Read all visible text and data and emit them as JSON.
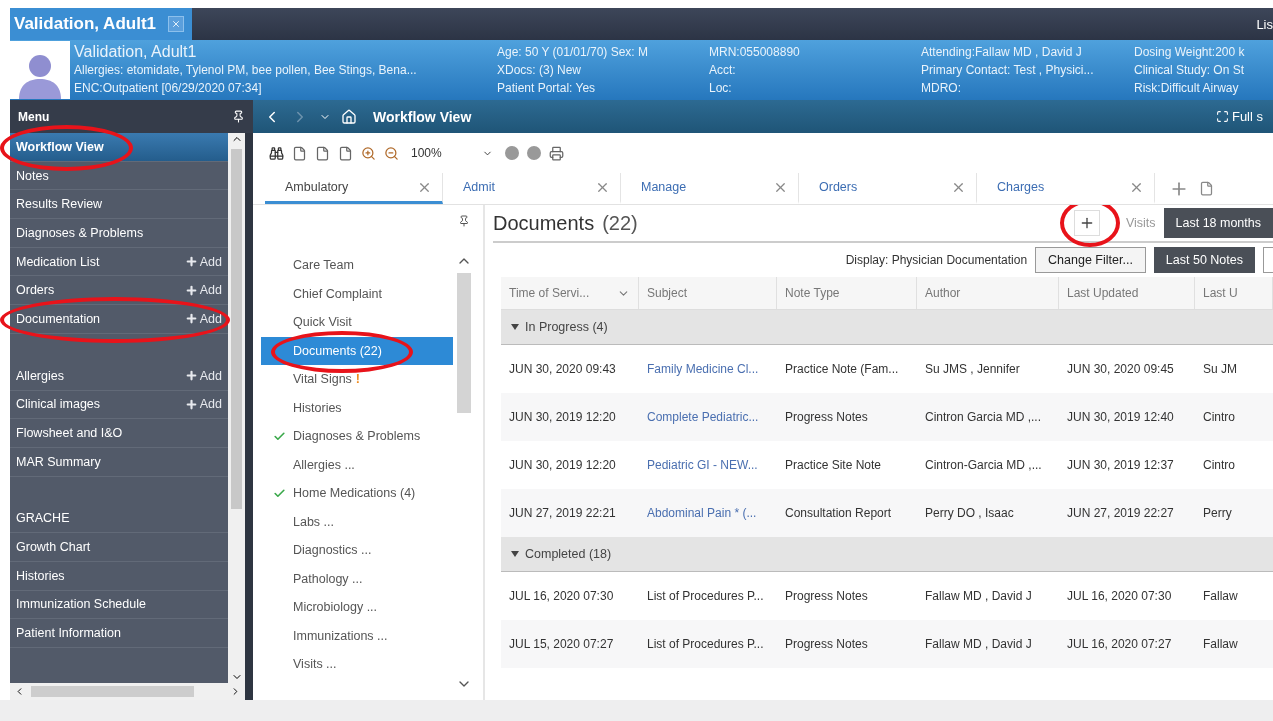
{
  "patient_tab": {
    "label": "Validation, Adult1"
  },
  "title_bar_right": "Lis",
  "banner": {
    "columns": [
      [
        "Validation, Adult1",
        "Allergies: etomidate, Tylenol PM, bee pollen, Bee Stings, Bena...",
        "ENC:Outpatient [06/29/2020 07:34]"
      ],
      [
        "Age: 50 Y (01/01/70) Sex: M",
        "XDocs: (3) New",
        "Patient Portal: Yes"
      ],
      [
        "MRN:055008890",
        "Acct:",
        "Loc:"
      ],
      [
        "Attending:Fallaw MD , David J",
        "Primary Contact: Test , Physici...",
        "MDRO:"
      ],
      [
        "Dosing Weight:200 k",
        "Clinical Study: On St",
        "Risk:Difficult Airway"
      ]
    ]
  },
  "menu": {
    "title": "Menu",
    "groups": [
      {
        "items": [
          {
            "label": "Workflow View",
            "selected": true,
            "circled": true
          },
          {
            "label": "Notes",
            "selected": false,
            "circled": false
          },
          {
            "label": "Results Review",
            "selected": false,
            "circled": false
          },
          {
            "label": "Diagnoses & Problems",
            "selected": false,
            "circled": false
          },
          {
            "label": "Medication List",
            "add": "Add",
            "selected": false,
            "circled": false
          },
          {
            "label": "Orders",
            "add": "Add",
            "selected": false,
            "circled": false
          },
          {
            "label": "Documentation",
            "add": "Add",
            "selected": false,
            "circled": true
          }
        ]
      },
      {
        "items": [
          {
            "label": "Allergies",
            "add": "Add",
            "selected": false,
            "circled": false
          },
          {
            "label": "Clinical images",
            "add": "Add",
            "selected": false,
            "circled": false
          },
          {
            "label": "Flowsheet and I&O",
            "selected": false,
            "circled": false
          },
          {
            "label": "MAR Summary",
            "selected": false,
            "circled": false
          }
        ]
      },
      {
        "items": [
          {
            "label": "GRACHE",
            "selected": false,
            "circled": false
          },
          {
            "label": "Growth Chart",
            "selected": false,
            "circled": false
          },
          {
            "label": "Histories",
            "selected": false,
            "circled": false
          },
          {
            "label": "Immunization Schedule",
            "selected": false,
            "circled": false
          },
          {
            "label": "Patient Information",
            "selected": false,
            "circled": false
          }
        ]
      }
    ]
  },
  "workflow_bar": {
    "title": "Workflow View",
    "right": "Full s"
  },
  "toolbar": {
    "zoom": "100%"
  },
  "tabs": [
    {
      "label": "Ambulatory",
      "selected": true
    },
    {
      "label": "Admit",
      "selected": false
    },
    {
      "label": "Manage",
      "selected": false
    },
    {
      "label": "Orders",
      "selected": false
    },
    {
      "label": "Charges",
      "selected": false
    }
  ],
  "nav": [
    {
      "label": "Care Team",
      "selected": false,
      "checked": false,
      "circled": false
    },
    {
      "label": "Chief Complaint",
      "selected": false,
      "checked": false,
      "circled": false
    },
    {
      "label": "Quick Visit",
      "selected": false,
      "checked": false,
      "circled": false
    },
    {
      "label": "Documents (22)",
      "selected": true,
      "checked": false,
      "circled": true
    },
    {
      "label": "Vital Signs",
      "badge": "!",
      "selected": false,
      "checked": false,
      "circled": false
    },
    {
      "label": "Histories",
      "selected": false,
      "checked": false,
      "circled": false
    },
    {
      "label": "Diagnoses & Problems",
      "selected": false,
      "checked": true,
      "circled": false
    },
    {
      "label": "Allergies ...",
      "selected": false,
      "checked": false,
      "circled": false
    },
    {
      "label": "Home Medications (4)",
      "selected": false,
      "checked": true,
      "circled": false
    },
    {
      "label": "Labs ...",
      "selected": false,
      "checked": false,
      "circled": false
    },
    {
      "label": "Diagnostics ...",
      "selected": false,
      "checked": false,
      "circled": false
    },
    {
      "label": "Pathology ...",
      "selected": false,
      "checked": false,
      "circled": false
    },
    {
      "label": "Microbiology ...",
      "selected": false,
      "checked": false,
      "circled": false
    },
    {
      "label": "Immunizations ...",
      "selected": false,
      "checked": false,
      "circled": false
    },
    {
      "label": "Visits ...",
      "selected": false,
      "checked": false,
      "circled": false
    }
  ],
  "documents": {
    "title": "Documents",
    "count": "(22)",
    "add_circled": true,
    "visits": "Visits",
    "range": "Last 18 months",
    "display": "Display: Physician Documentation",
    "filter": "Change Filter...",
    "notes": "Last 50 Notes",
    "columns": [
      "Time of Servi...",
      "Subject",
      "Note Type",
      "Author",
      "Last Updated",
      "Last U"
    ],
    "groups": [
      {
        "label": "In Progress (4)",
        "expanded": true,
        "rows": [
          {
            "link": true,
            "cells": [
              "JUN 30, 2020 09:43",
              "Family Medicine Cl...",
              "Practice Note (Fam...",
              "Su JMS , Jennifer",
              "JUN 30, 2020 09:45",
              "Su JM"
            ]
          },
          {
            "link": true,
            "cells": [
              "JUN 30, 2019 12:20",
              "Complete Pediatric...",
              "Progress Notes",
              "Cintron Garcia MD ,...",
              "JUN 30, 2019 12:40",
              "Cintro"
            ]
          },
          {
            "link": true,
            "cells": [
              "JUN 30, 2019 12:20",
              "Pediatric GI - NEW...",
              "Practice Site Note",
              "Cintron-Garcia MD ,...",
              "JUN 30, 2019 12:37",
              "Cintro"
            ]
          },
          {
            "link": true,
            "cells": [
              "JUN 27, 2019 22:21",
              "Abdominal Pain * (...",
              "Consultation Report",
              "Perry DO , Isaac",
              "JUN 27, 2019 22:27",
              "Perry"
            ]
          }
        ]
      },
      {
        "label": "Completed (18)",
        "expanded": true,
        "rows": [
          {
            "link": false,
            "cells": [
              "JUL 16, 2020 07:30",
              "List of Procedures P...",
              "Progress Notes",
              "Fallaw MD , David J",
              "JUL 16, 2020 07:30",
              "Fallaw"
            ]
          },
          {
            "link": false,
            "cells": [
              "JUL 15, 2020 07:27",
              "List of Procedures P...",
              "Progress Notes",
              "Fallaw MD , David J",
              "JUL 16, 2020 07:27",
              "Fallaw"
            ]
          }
        ]
      }
    ]
  }
}
